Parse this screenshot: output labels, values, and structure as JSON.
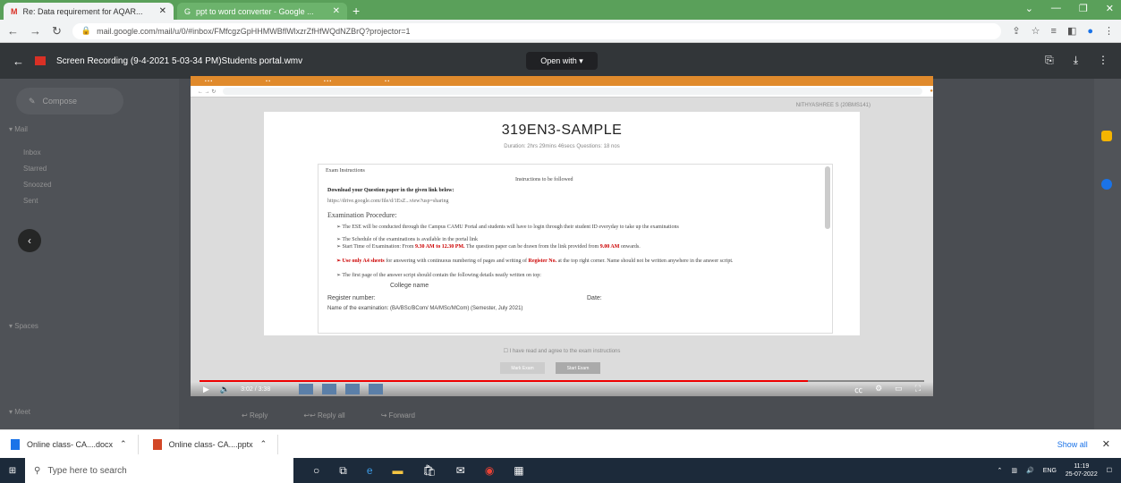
{
  "browser": {
    "tabs": [
      {
        "title": "Re: Data requirement for AQAR..."
      },
      {
        "title": "ppt to word converter - Google ..."
      }
    ],
    "url": "mail.google.com/mail/u/0/#inbox/FMfcgzGpHHMWBflWlxzrZfHfWQdNZBrQ?projector=1"
  },
  "viewer": {
    "file_title": "Screen Recording (9-4-2021 5-03-34 PM)Students portal.wmv",
    "open_with": "Open with"
  },
  "video": {
    "user_name": "NITHYASHREE S (20BMS141)",
    "exam_title": "319EN3-SAMPLE",
    "exam_meta": "Duration: 2hrs 29mins 46secs    Questions: 18 nos",
    "inst_header": "Exam Instructions",
    "inst_sub": "Instructions to be followed",
    "download_line": "Download your Question paper in the given link below:",
    "link_line": "https://drive.google.com/file/d/1EsZ...view?usp=sharing",
    "procedure_head": "Examination Procedure:",
    "proc_1": "➢ The ESE will be conducted through the Campus CAMU Portal and students will have to login through their student ID everyday to take up the examinations",
    "proc_2": "➢ The Schedule of the examinations is available in the portal link",
    "proc_3a": "➢ Start Time of Examination: From",
    "proc_3b": "9.30 AM to 12.30 PM.",
    "proc_3c": "The question paper can be drawn from the link provided from",
    "proc_3d": "9.00 AM",
    "proc_3e": "onwards.",
    "proc_4a": "➢ Use only A4 sheets",
    "proc_4b": "for answering with continuous numbering of pages and writing of",
    "proc_4c": "Register No.",
    "proc_4d": "at the top right corner. Name should not be written anywhere in the answer script.",
    "proc_5": "➢ The first page of the answer script should contain the following details neatly written on top:",
    "college_name": "College name",
    "register_number": "Register number:",
    "date": "Date:",
    "programme": "Name of the examination: (BA/BSc/BCom/ MA/MSc/MCom) (Semester, July 2021)",
    "agree": "☐ I have read and agree to the exam instructions",
    "btn_mark": "Mark Exam",
    "btn_start": "Start Exam",
    "time": "3:02 / 3:38",
    "progress": 0.84
  },
  "gmail": {
    "compose": "Compose",
    "reply": "Reply",
    "reply_all": "Reply all",
    "forward": "Forward"
  },
  "downloads": {
    "items": [
      {
        "name": "Online class- CA....docx"
      },
      {
        "name": "Online class- CA....pptx"
      }
    ],
    "show_all": "Show all"
  },
  "taskbar": {
    "search_placeholder": "Type here to search",
    "lang": "ENG",
    "time": "11:19",
    "date": "25-07-2022"
  }
}
